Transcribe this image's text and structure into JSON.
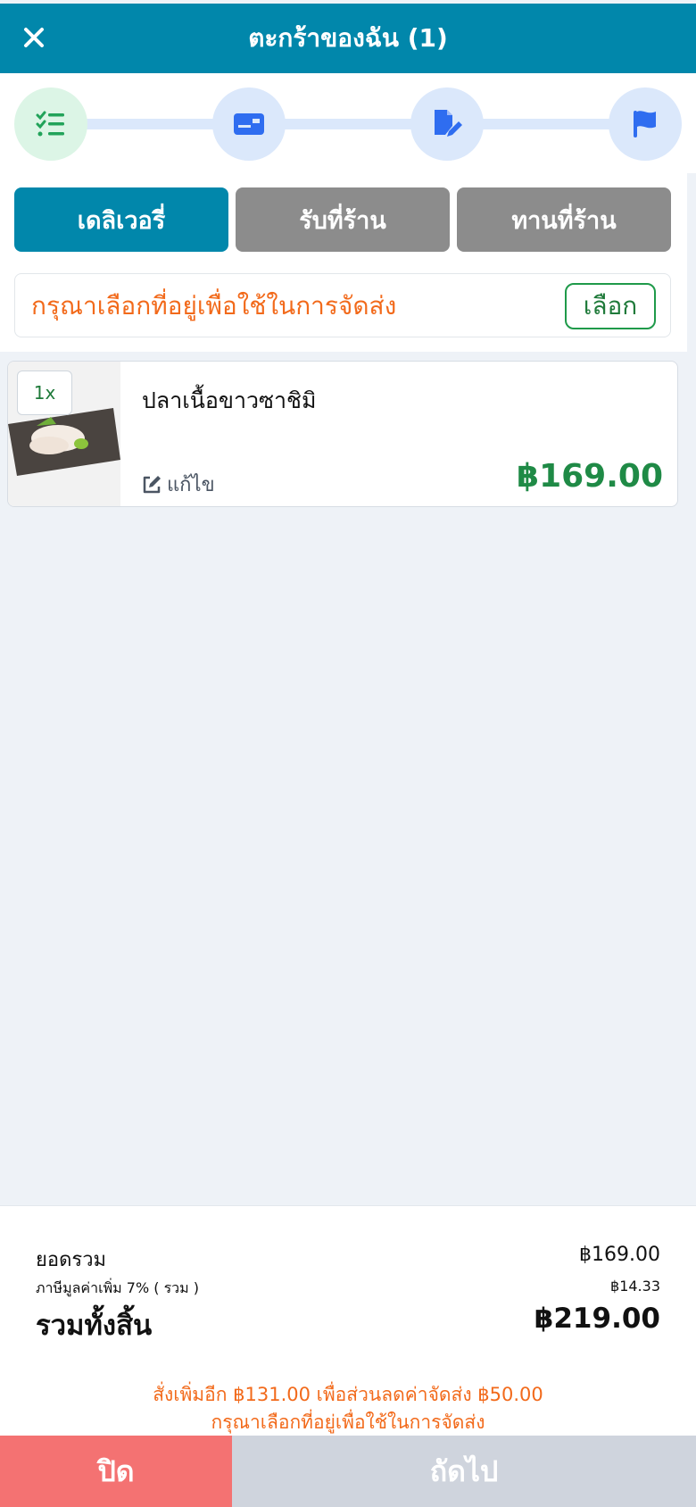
{
  "header": {
    "title": "ตะกร้าของฉัน (1)",
    "close_icon": "close-icon"
  },
  "steps": [
    {
      "icon": "checklist-icon",
      "status": "done"
    },
    {
      "icon": "card-icon",
      "status": "pending"
    },
    {
      "icon": "note-edit-icon",
      "status": "pending"
    },
    {
      "icon": "flag-icon",
      "status": "pending"
    }
  ],
  "tabs": [
    {
      "label": "เดลิเวอรี่",
      "active": true
    },
    {
      "label": "รับที่ร้าน",
      "active": false
    },
    {
      "label": "ทานที่ร้าน",
      "active": false
    }
  ],
  "address": {
    "message": "กรุณาเลือกที่อยู่เพื่อใช้ในการจัดส่ง",
    "button_label": "เลือก"
  },
  "cart": {
    "items": [
      {
        "qty": "1x",
        "name": "ปลาเนื้อขาวซาชิมิ",
        "edit_label": "แก้ไข",
        "price": "฿169.00"
      }
    ]
  },
  "summary": {
    "subtotal_label": "ยอดรวม",
    "subtotal_value": "฿169.00",
    "vat_label": "ภาษีมูลค่าเพิ่ม 7% ( รวม )",
    "vat_value": "฿14.33",
    "total_label": "รวมทั้งสิ้น",
    "total_value": "฿219.00",
    "promo_line1": "สั่งเพิ่มอีก ฿131.00 เพื่อส่วนลดค่าจัดส่ง ฿50.00",
    "promo_line2": "กรุณาเลือกที่อยู่เพื่อใช้ในการจัดส่ง"
  },
  "footer": {
    "close_label": "ปิด",
    "next_label": "ถัดไป"
  },
  "colors": {
    "primary": "#0187ab",
    "warning": "#f26a1b",
    "success": "#1f8a46",
    "danger": "#f47272",
    "disabled": "#cfd4dd"
  }
}
